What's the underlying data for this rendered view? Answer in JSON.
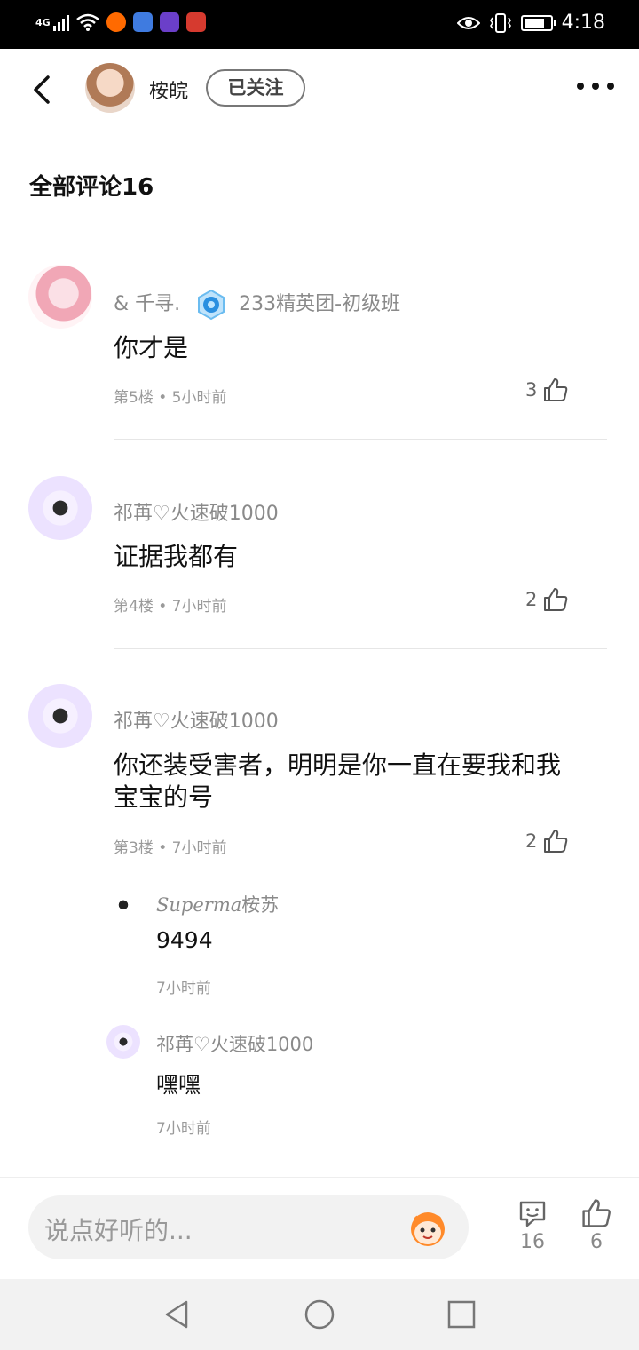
{
  "status_bar": {
    "network_label": "4G",
    "time": "4:18",
    "battery_level": 0.8,
    "app_icons": [
      "taobao-icon",
      "music-icon",
      "browser-icon",
      "huawei-store-icon"
    ]
  },
  "header": {
    "author_name": "桉皖",
    "follow_label": "已关注"
  },
  "comments_section": {
    "title": "全部评论16"
  },
  "comments": [
    {
      "author": "& 千寻.",
      "badge_label": "233精英团-初级班",
      "text": "你才是",
      "floor": "第5楼",
      "time": "5小时前",
      "likes": "3"
    },
    {
      "author": "祁苒♡火速破1000",
      "text": "证据我都有",
      "floor": "第4楼",
      "time": "7小时前",
      "likes": "2"
    },
    {
      "author": "祁苒♡火速破1000",
      "text": "你还装受害者，明明是你一直在要我和我宝宝的号",
      "floor": "第3楼",
      "time": "7小时前",
      "likes": "2"
    }
  ],
  "replies": [
    {
      "author_prefix": "Superma",
      "author_suffix": "桉苏",
      "text": "9494",
      "time": "7小时前"
    },
    {
      "author": "祁苒♡火速破1000",
      "text": "嘿嘿",
      "time": "7小时前"
    }
  ],
  "meta_dot": "•",
  "bottom_bar": {
    "input_placeholder": "说点好听的...",
    "comment_count": "16",
    "like_count": "6"
  },
  "colors": {
    "accent_text": "#111111",
    "muted_text": "#8a8a8a",
    "badge_blue": "#2a8fe0"
  }
}
